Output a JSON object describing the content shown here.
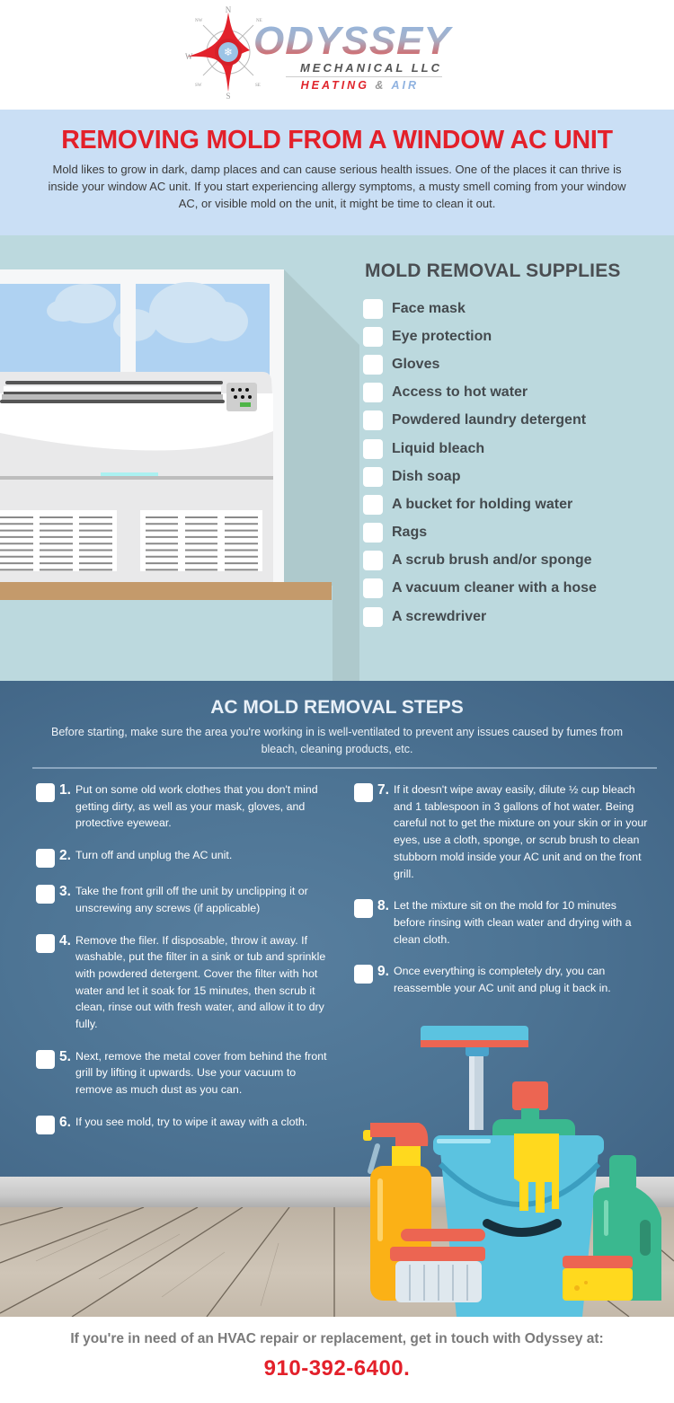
{
  "logo": {
    "compass_labels": {
      "n": "N",
      "ne": "NE",
      "e": "",
      "se": "SE",
      "s": "S",
      "sw": "SW",
      "w": "W",
      "nw": "NW"
    },
    "brand_name": "ODYSSEY",
    "subtitle": "MECHANICAL LLC",
    "tagline_part1": "HEATING",
    "tagline_amp": "&",
    "tagline_part2": "AIR",
    "colors": {
      "red": "#e0252c",
      "blue": "#8fb2e0",
      "gray": "#555555"
    }
  },
  "intro": {
    "title": "REMOVING MOLD FROM A WINDOW AC UNIT",
    "body": "Mold likes to grow in dark, damp places and can cause serious health issues. One of the places it can thrive is inside your window AC unit. If you start experiencing allergy symptoms, a musty smell coming from your window AC, or visible mold on the unit, it might be time to clean it out."
  },
  "supplies": {
    "title": "MOLD REMOVAL SUPPLIES",
    "items": [
      {
        "label": "Face mask",
        "checked": false
      },
      {
        "label": "Eye protection",
        "checked": false
      },
      {
        "label": "Gloves",
        "checked": false
      },
      {
        "label": "Access to hot water",
        "checked": false
      },
      {
        "label": "Powdered laundry detergent",
        "checked": false
      },
      {
        "label": "Liquid bleach",
        "checked": false
      },
      {
        "label": "Dish soap",
        "checked": false
      },
      {
        "label": "A bucket for holding water",
        "checked": false
      },
      {
        "label": "Rags",
        "checked": false
      },
      {
        "label": "A scrub brush and/or sponge",
        "checked": false
      },
      {
        "label": "A vacuum cleaner with a hose",
        "checked": false
      },
      {
        "label": "A screwdriver",
        "checked": false
      }
    ],
    "illustration": "window-ac-unit-illustration"
  },
  "steps": {
    "title": "AC MOLD REMOVAL STEPS",
    "lead": "Before starting, make sure the area you're working in is well-ventilated to prevent any issues caused by fumes from bleach, cleaning products, etc.",
    "left": [
      {
        "num": "1.",
        "text": "Put on some old work clothes that you don't mind getting dirty, as well as your mask, gloves, and protective eyewear."
      },
      {
        "num": "2.",
        "text": "Turn off and unplug the AC unit."
      },
      {
        "num": "3.",
        "text": "Take the front grill off the unit by unclipping it or unscrewing any screws (if applicable)"
      },
      {
        "num": "4.",
        "text": "Remove the filer. If disposable, throw it away. If washable, put the filter in a sink or tub and sprinkle with powdered detergent. Cover the filter with hot water and let it soak for 15 minutes, then scrub it clean, rinse out with fresh water, and allow it to dry fully."
      },
      {
        "num": "5.",
        "text": "Next, remove the metal cover from behind the front grill by lifting it upwards. Use your vacuum to remove as much dust as you can."
      },
      {
        "num": "6.",
        "text": "If you see mold, try to wipe it away with a cloth."
      }
    ],
    "right": [
      {
        "num": "7.",
        "text": "If it doesn't wipe away easily, dilute ½ cup bleach and 1 tablespoon in 3 gallons of hot water. Being careful not to get the mixture on your skin or in your eyes, use a cloth, sponge, or scrub brush to clean stubborn mold inside your AC unit and on the front grill."
      },
      {
        "num": "8.",
        "text": "Let the mixture sit on the mold for 10 minutes before rinsing with clean water and drying with a clean cloth."
      },
      {
        "num": "9.",
        "text": "Once everything is completely dry, you can reassemble your AC unit and plug it back in."
      }
    ],
    "illustration": "cleaning-supplies-illustration"
  },
  "footer": {
    "cta": "If you're in need of an HVAC repair or replacement, get in touch with Odyssey at:",
    "phone": "910-392-6400."
  }
}
